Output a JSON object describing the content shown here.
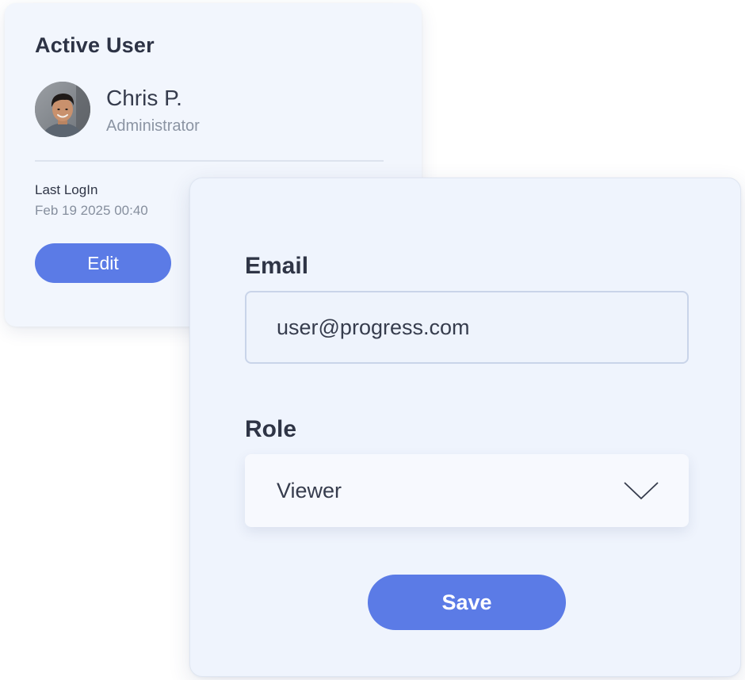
{
  "user_card": {
    "title": "Active User",
    "user": {
      "name": "Chris P.",
      "role": "Administrator"
    },
    "last_login": {
      "label": "Last LogIn",
      "value": "Feb 19 2025 00:40"
    },
    "edit_label": "Edit"
  },
  "form": {
    "email": {
      "label": "Email",
      "value": "user@progress.com"
    },
    "role": {
      "label": "Role",
      "selected": "Viewer",
      "icon": "chevron-down-icon"
    },
    "save_label": "Save"
  },
  "colors": {
    "accent": "#5b7be6",
    "card_background": "#f2f6fd",
    "heading_text": "#2d3345",
    "muted_text": "#8b94a3"
  }
}
